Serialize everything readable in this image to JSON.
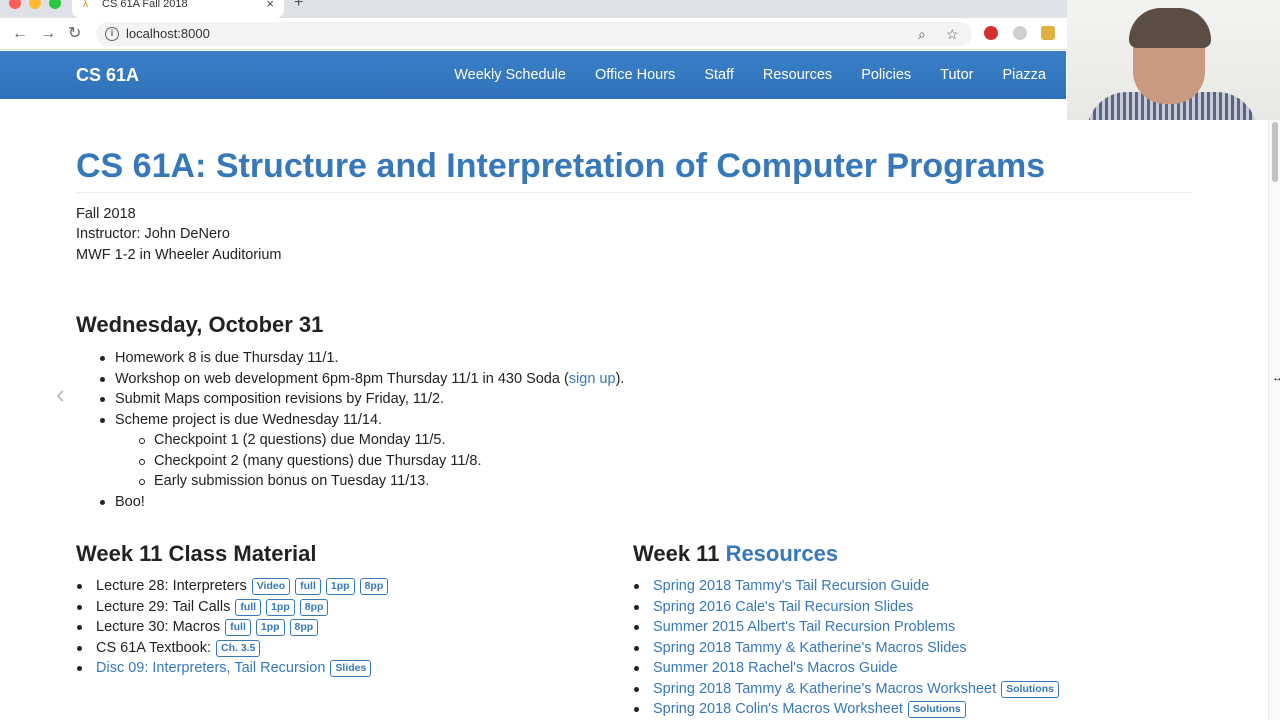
{
  "browser": {
    "tab_title": "CS 61A Fall 2018",
    "tab_close": "×",
    "new_tab": "+",
    "url": "localhost:8000",
    "back": "←",
    "forward": "→",
    "reload": "↻",
    "zoom_icon": "⌕",
    "star_icon": "☆",
    "info_glyph": "i"
  },
  "navbar": {
    "brand": "CS 61A",
    "links": [
      "Weekly Schedule",
      "Office Hours",
      "Staff",
      "Resources",
      "Policies",
      "Tutor",
      "Piazza"
    ]
  },
  "page": {
    "title": "CS 61A: Structure and Interpretation of Computer Programs",
    "term": "Fall 2018",
    "instructor": "Instructor: John DeNero",
    "schedule": "MWF 1-2 in Wheeler Auditorium",
    "prev_arrow": "‹"
  },
  "announcements": {
    "heading": "Wednesday, October 31",
    "items": {
      "hw": "Homework 8 is due Thursday 11/1.",
      "workshop_pre": "Workshop on web development 6pm-8pm Thursday 11/1 in 430 Soda (",
      "workshop_link": "sign up",
      "workshop_post": ").",
      "maps": "Submit Maps composition revisions by Friday, 11/2.",
      "scheme": "Scheme project is due Wednesday 11/14.",
      "cp1": "Checkpoint 1 (2 questions) due Monday 11/5.",
      "cp2": "Checkpoint 2 (many questions) due Thursday 11/8.",
      "early": "Early submission bonus on Tuesday 11/13.",
      "boo": "Boo!"
    }
  },
  "class_material": {
    "heading": "Week 11 Class Material",
    "lecture28": {
      "label": "Lecture 28: Interpreters",
      "badges": [
        "Video",
        "full",
        "1pp",
        "8pp"
      ]
    },
    "lecture29": {
      "label": "Lecture 29: Tail Calls",
      "badges": [
        "full",
        "1pp",
        "8pp"
      ]
    },
    "lecture30": {
      "label": "Lecture 30: Macros",
      "badges": [
        "full",
        "1pp",
        "8pp"
      ]
    },
    "textbook": {
      "label": "CS 61A Textbook:",
      "badges": [
        "Ch. 3.5"
      ]
    },
    "disc": {
      "label": "Disc 09: Interpreters, Tail Recursion",
      "badges": [
        "Slides"
      ]
    }
  },
  "resources": {
    "heading_prefix": "Week 11 ",
    "heading_link": "Resources",
    "items": [
      "Spring 2018 Tammy's Tail Recursion Guide",
      "Spring 2016 Cale's Tail Recursion Slides",
      "Summer 2015 Albert's Tail Recursion Problems",
      "Spring 2018 Tammy & Katherine's Macros Slides",
      "Summer 2018 Rachel's Macros Guide",
      "Spring 2018 Tammy & Katherine's Macros Worksheet",
      "Spring 2018 Colin's Macros Worksheet"
    ],
    "solutions_badge": "Solutions"
  },
  "colors": {
    "navbar": "#3178c6",
    "link": "#3778bb",
    "text": "#222222"
  }
}
